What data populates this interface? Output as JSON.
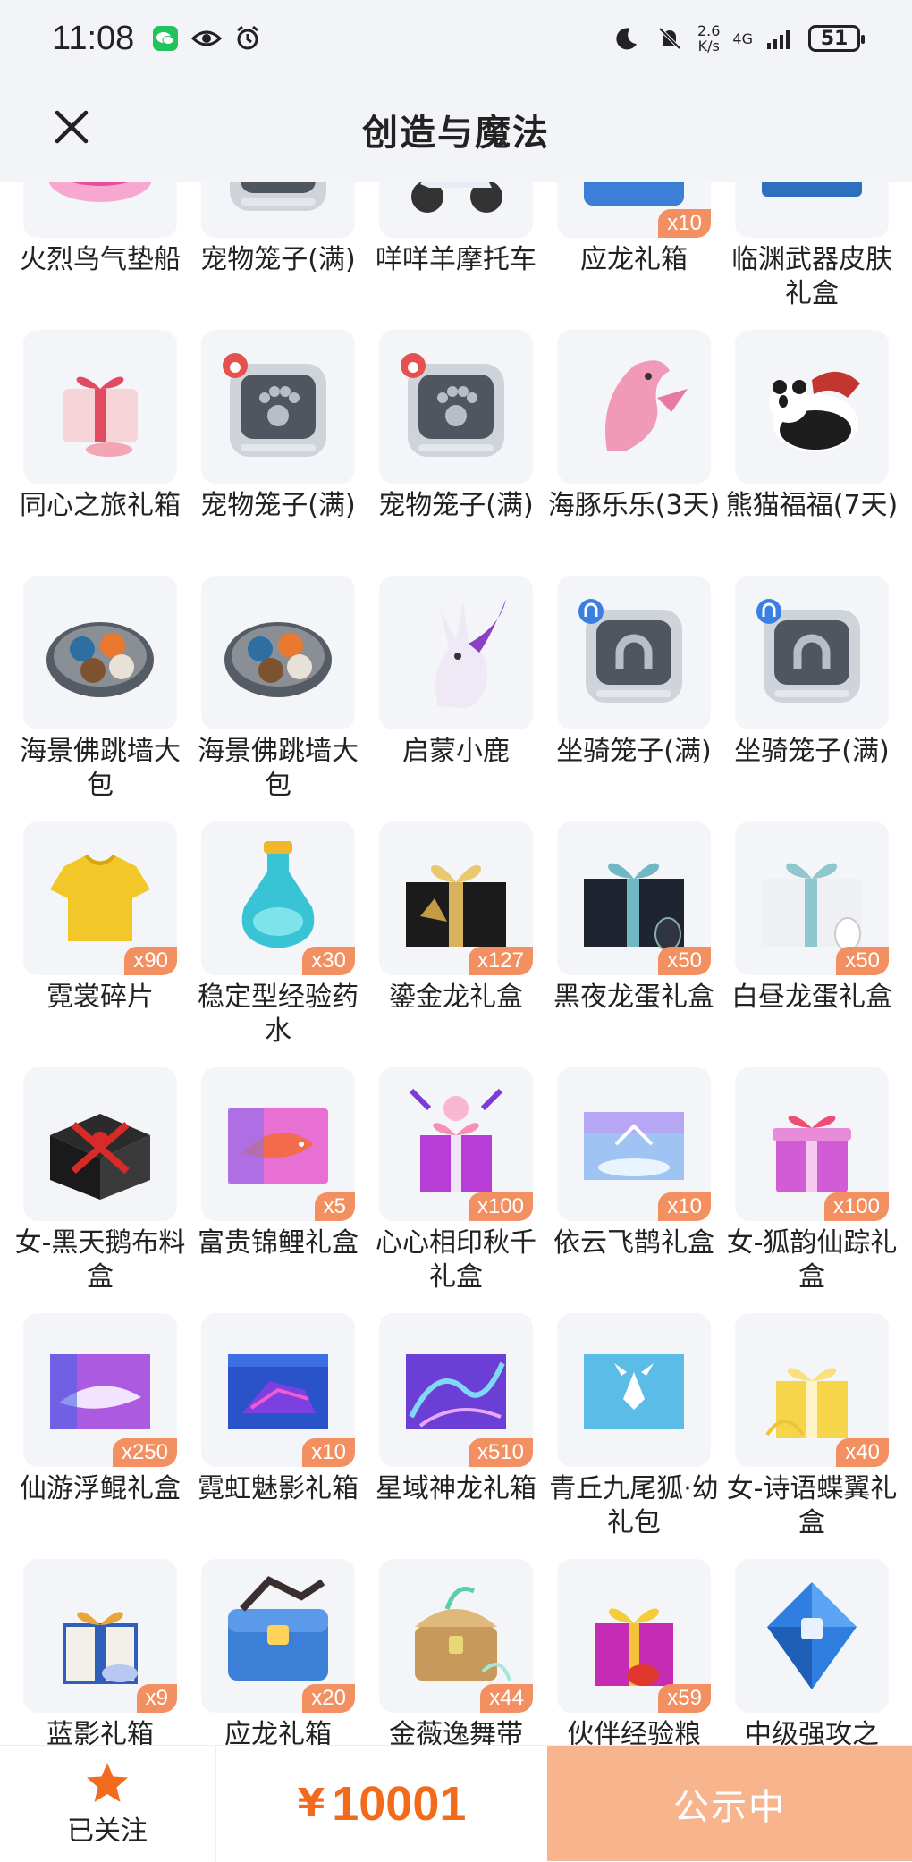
{
  "status_bar": {
    "time": "11:08",
    "net_speed_value": "2.6",
    "net_speed_unit": "K/s",
    "network": "4G",
    "battery": "51"
  },
  "header": {
    "title": "创造与魔法"
  },
  "items": [
    {
      "name": "火烈鸟气垫船",
      "qty": "",
      "icon": "pink-boat"
    },
    {
      "name": "宠物笼子(满)",
      "qty": "",
      "icon": "pet-cage"
    },
    {
      "name": "咩咩羊摩托车",
      "qty": "",
      "icon": "scooter"
    },
    {
      "name": "应龙礼箱",
      "qty": "x10",
      "icon": "blue-chest"
    },
    {
      "name": "临渊武器皮肤礼盒",
      "qty": "",
      "icon": "blue-box"
    },
    {
      "name": "同心之旅礼箱",
      "qty": "",
      "icon": "heart-gift"
    },
    {
      "name": "宠物笼子(满)",
      "qty": "",
      "icon": "pet-cage"
    },
    {
      "name": "宠物笼子(满)",
      "qty": "",
      "icon": "pet-cage"
    },
    {
      "name": "海豚乐乐(3天)",
      "qty": "",
      "icon": "dolphin"
    },
    {
      "name": "熊猫福福(7天)",
      "qty": "",
      "icon": "panda"
    },
    {
      "name": "海景佛跳墙大包",
      "qty": "",
      "icon": "dumpling-plate"
    },
    {
      "name": "海景佛跳墙大包",
      "qty": "",
      "icon": "dumpling-plate"
    },
    {
      "name": "启蒙小鹿",
      "qty": "",
      "icon": "deer"
    },
    {
      "name": "坐骑笼子(满)",
      "qty": "",
      "icon": "mount-cage"
    },
    {
      "name": "坐骑笼子(满)",
      "qty": "",
      "icon": "mount-cage"
    },
    {
      "name": "霓裳碎片",
      "qty": "x90",
      "icon": "tshirt"
    },
    {
      "name": "稳定型经验药水",
      "qty": "x30",
      "icon": "potion"
    },
    {
      "name": "鎏金龙礼盒",
      "qty": "x127",
      "icon": "gold-box"
    },
    {
      "name": "黑夜龙蛋礼盒",
      "qty": "x50",
      "icon": "dark-box"
    },
    {
      "name": "白昼龙蛋礼盒",
      "qty": "x50",
      "icon": "white-box"
    },
    {
      "name": "女-黑天鹅布料盒",
      "qty": "",
      "icon": "red-ribbon-box"
    },
    {
      "name": "富贵锦鲤礼盒",
      "qty": "x5",
      "icon": "koi-box"
    },
    {
      "name": "心心相印秋千礼盒",
      "qty": "x100",
      "icon": "pink-gift"
    },
    {
      "name": "依云飞鹊礼盒",
      "qty": "x10",
      "icon": "sky-box"
    },
    {
      "name": "女-狐韵仙踪礼盒",
      "qty": "x100",
      "icon": "purple-gift"
    },
    {
      "name": "仙游浮鲲礼盒",
      "qty": "x250",
      "icon": "whale-box"
    },
    {
      "name": "霓虹魅影礼箱",
      "qty": "x10",
      "icon": "neon-box"
    },
    {
      "name": "星域神龙礼箱",
      "qty": "x510",
      "icon": "dragon-box"
    },
    {
      "name": "青丘九尾狐·幼礼包",
      "qty": "",
      "icon": "fox-box"
    },
    {
      "name": "女-诗语蝶翼礼盒",
      "qty": "x40",
      "icon": "yellow-gift"
    },
    {
      "name": "蓝影礼箱",
      "qty": "x9",
      "icon": "blue-gift"
    },
    {
      "name": "应龙礼箱",
      "qty": "x20",
      "icon": "blue-chest"
    },
    {
      "name": "金薇逸舞带",
      "qty": "x44",
      "icon": "treasure"
    },
    {
      "name": "伙伴经验粮",
      "qty": "x59",
      "icon": "magenta-gift"
    },
    {
      "name": "中级强攻之",
      "qty": "",
      "icon": "gem"
    }
  ],
  "bottom_bar": {
    "follow_label": "已关注",
    "price_symbol": "¥",
    "price_value": "10001",
    "status_label": "公示中"
  },
  "colors": {
    "accent": "#f26b1d",
    "qty_badge": "#f39062",
    "status_button": "#f8b48c",
    "header_bg": "#f2f4f7"
  }
}
